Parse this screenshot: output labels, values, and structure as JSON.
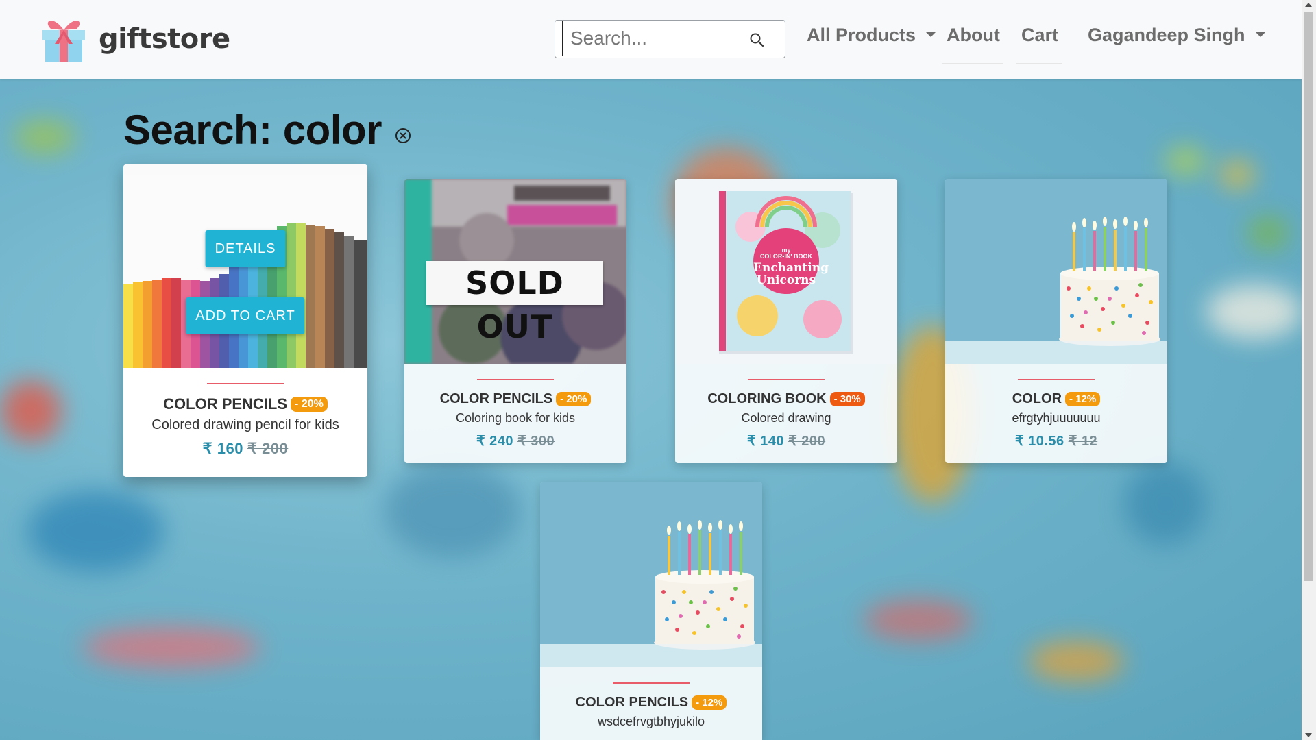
{
  "brand": {
    "name": "giftstore"
  },
  "search": {
    "placeholder": "Search...",
    "value": ""
  },
  "nav": {
    "all_products": "All Products",
    "about": "About",
    "cart": "Cart",
    "user": "Gagandeep Singh"
  },
  "page": {
    "title": "Search: color"
  },
  "buttons": {
    "details": "DETAILS",
    "add_to_cart": "ADD TO CART"
  },
  "sold_out_label": "SOLD OUT",
  "products": [
    {
      "name": "COLOR PENCILS",
      "discount": "- 20%",
      "description": "Colored drawing pencil for kids",
      "price": "₹ 160",
      "old_price": "₹ 200",
      "image": "color-pencils-photo",
      "sold_out": false
    },
    {
      "name": "COLOR PENCILS",
      "discount": "- 20%",
      "description": "Coloring book for kids",
      "price": "₹ 240",
      "old_price": "₹ 300",
      "image": "therapy-coloring-book-photo",
      "sold_out": true
    },
    {
      "name": "COLORING BOOK",
      "discount": "- 30%",
      "description": "Colored drawing",
      "price": "₹ 140",
      "old_price": "₹ 200",
      "image": "enchanting-unicorns-book-photo",
      "sold_out": false,
      "cover_text": [
        "my",
        "COLOR-IN' BOOK",
        "Enchanting",
        "Unicorns"
      ]
    },
    {
      "name": "COLOR",
      "discount": "- 12%",
      "description": "efrgtyhjuuuuuuu",
      "price": "₹ 10.56",
      "old_price": "₹ 12",
      "image": "birthday-cake-photo",
      "sold_out": false
    },
    {
      "name": "COLOR PENCILS",
      "discount": "- 12%",
      "description": "wsdcefrvgtbhyjukilo",
      "image": "birthday-cake-photo",
      "sold_out": false
    }
  ],
  "colors": {
    "accent": "#20b3d4",
    "badge": "#f39a0d",
    "divider": "#e85c6a",
    "price": "#2a8eaa"
  }
}
